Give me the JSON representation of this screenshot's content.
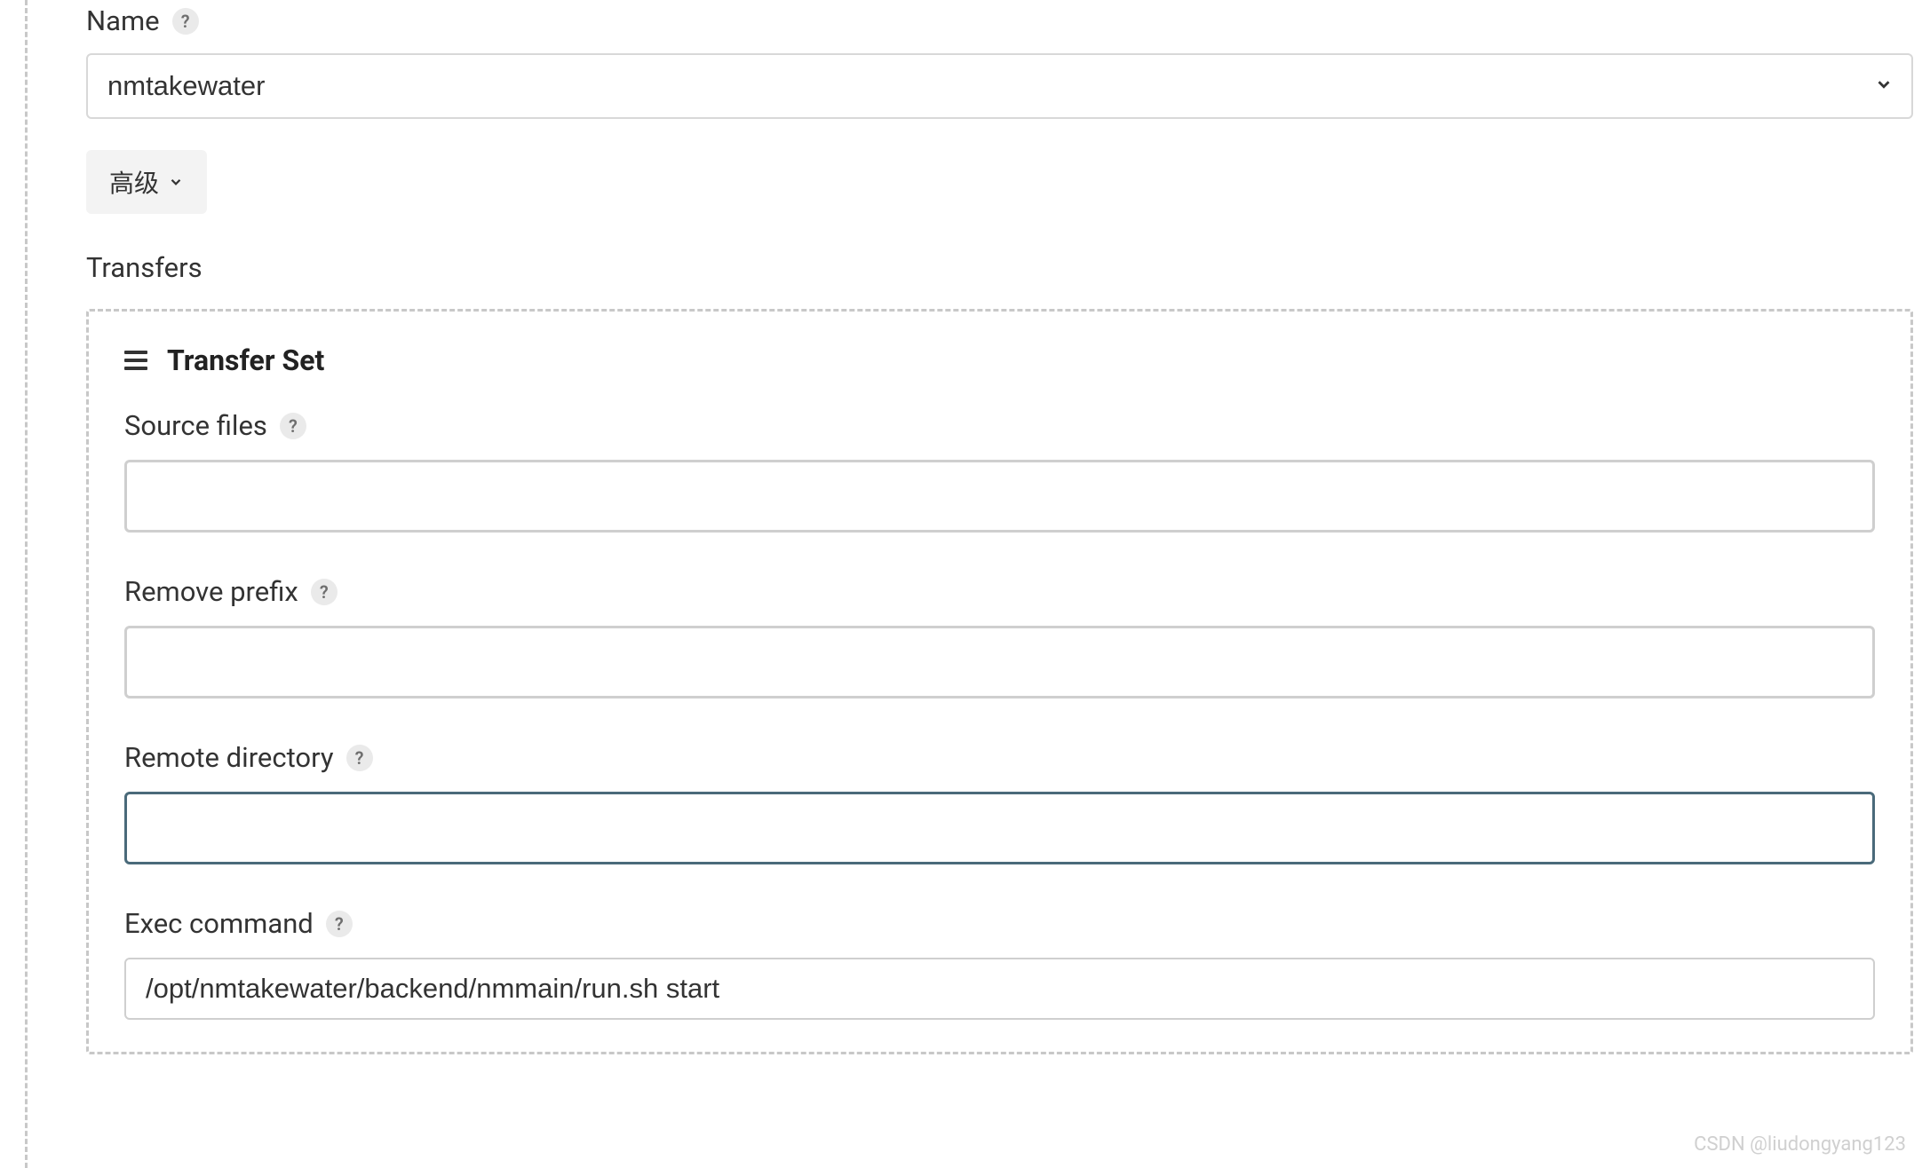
{
  "nameField": {
    "label": "Name",
    "value": "nmtakewater"
  },
  "advancedButton": {
    "label": "高级"
  },
  "transfersSection": {
    "label": "Transfers",
    "setTitle": "Transfer Set",
    "fields": {
      "sourceFiles": {
        "label": "Source files",
        "value": ""
      },
      "removePrefix": {
        "label": "Remove prefix",
        "value": ""
      },
      "remoteDirectory": {
        "label": "Remote directory",
        "value": ""
      },
      "execCommand": {
        "label": "Exec command",
        "value": "/opt/nmtakewater/backend/nmmain/run.sh start"
      }
    }
  },
  "watermark": "CSDN @liudongyang123"
}
